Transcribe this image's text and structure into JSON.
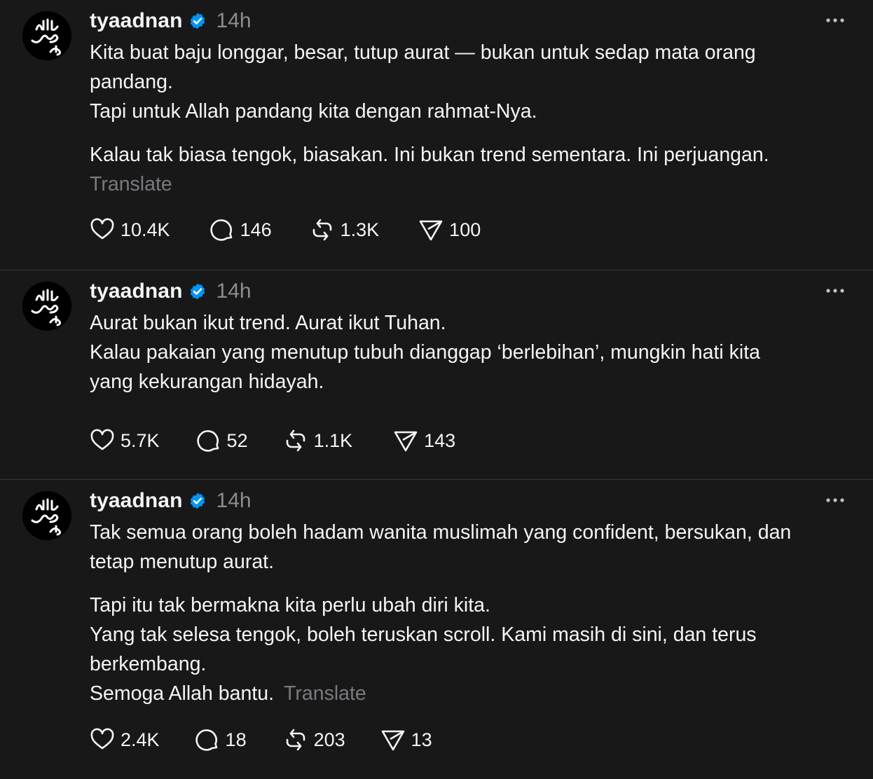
{
  "posts": [
    {
      "username": "tyaadnan",
      "time": "14h",
      "paragraphs": [
        [
          "Kita buat baju longgar, besar, tutup aurat — bukan untuk sedap mata orang",
          "pandang.",
          "Tapi untuk Allah pandang kita dengan rahmat-Nya."
        ],
        [
          "Kalau tak biasa tengok, biasakan. Ini bukan trend sementara. Ini perjuangan."
        ]
      ],
      "translate": "Translate",
      "likes": "10.4K",
      "replies": "146",
      "reposts": "1.3K",
      "shares": "100"
    },
    {
      "username": "tyaadnan",
      "time": "14h",
      "paragraphs": [
        [
          "Aurat bukan ikut trend. Aurat ikut Tuhan.",
          "Kalau pakaian yang menutup tubuh dianggap ‘berlebihan’, mungkin hati kita",
          "yang kekurangan hidayah."
        ]
      ],
      "likes": "5.7K",
      "replies": "52",
      "reposts": "1.1K",
      "shares": "143"
    },
    {
      "username": "tyaadnan",
      "time": "14h",
      "paragraphs": [
        [
          "Tak semua orang boleh hadam wanita muslimah yang confident, bersukan, dan",
          "tetap menutup aurat."
        ],
        [
          "Tapi itu tak bermakna kita perlu ubah diri kita.",
          "Yang tak selesa tengok, boleh teruskan scroll. Kami masih di sini, dan terus",
          "berkembang.",
          "Semoga Allah bantu."
        ]
      ],
      "translate": "Translate",
      "likes": "2.4K",
      "replies": "18",
      "reposts": "203",
      "shares": "13"
    }
  ],
  "icons": {
    "avatar": "avatar-calligraphy-icon",
    "verified": "verified-badge-icon",
    "more": "more-options-icon",
    "like": "heart-icon",
    "reply": "comment-icon",
    "repost": "repost-icon",
    "share": "send-icon"
  },
  "colors": {
    "background": "#181818",
    "text": "#f3f5f7",
    "muted": "#8a8d91",
    "verified": "#0095f6",
    "divider": "#333638"
  },
  "avatar_text": "الله رسول محمد"
}
